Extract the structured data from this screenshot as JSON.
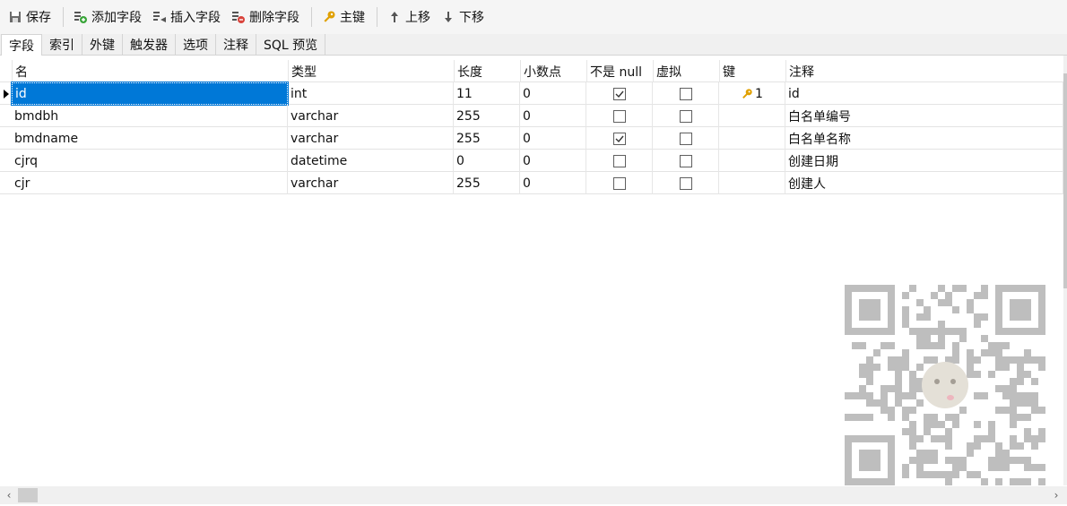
{
  "toolbar": {
    "save": "保存",
    "add_field": "添加字段",
    "insert_field": "插入字段",
    "delete_field": "删除字段",
    "primary_key": "主键",
    "move_up": "上移",
    "move_down": "下移"
  },
  "tabs": [
    "字段",
    "索引",
    "外键",
    "触发器",
    "选项",
    "注释",
    "SQL 预览"
  ],
  "grid": {
    "headers": [
      "名",
      "类型",
      "长度",
      "小数点",
      "不是 null",
      "虚拟",
      "键",
      "注释"
    ],
    "rows": [
      {
        "name": "id",
        "type": "int",
        "length": "11",
        "decimals": "0",
        "not_null": true,
        "virtual": false,
        "key": "1",
        "comment": "id"
      },
      {
        "name": "bmdbh",
        "type": "varchar",
        "length": "255",
        "decimals": "0",
        "not_null": false,
        "virtual": false,
        "key": "",
        "comment": "白名单编号"
      },
      {
        "name": "bmdname",
        "type": "varchar",
        "length": "255",
        "decimals": "0",
        "not_null": true,
        "virtual": false,
        "key": "",
        "comment": "白名单名称"
      },
      {
        "name": "cjrq",
        "type": "datetime",
        "length": "0",
        "decimals": "0",
        "not_null": false,
        "virtual": false,
        "key": "",
        "comment": "创建日期"
      },
      {
        "name": "cjr",
        "type": "varchar",
        "length": "255",
        "decimals": "0",
        "not_null": false,
        "virtual": false,
        "key": "",
        "comment": "创建人"
      }
    ]
  },
  "colors": {
    "selection": "#0078d7",
    "key_icon": "#e0a000"
  }
}
